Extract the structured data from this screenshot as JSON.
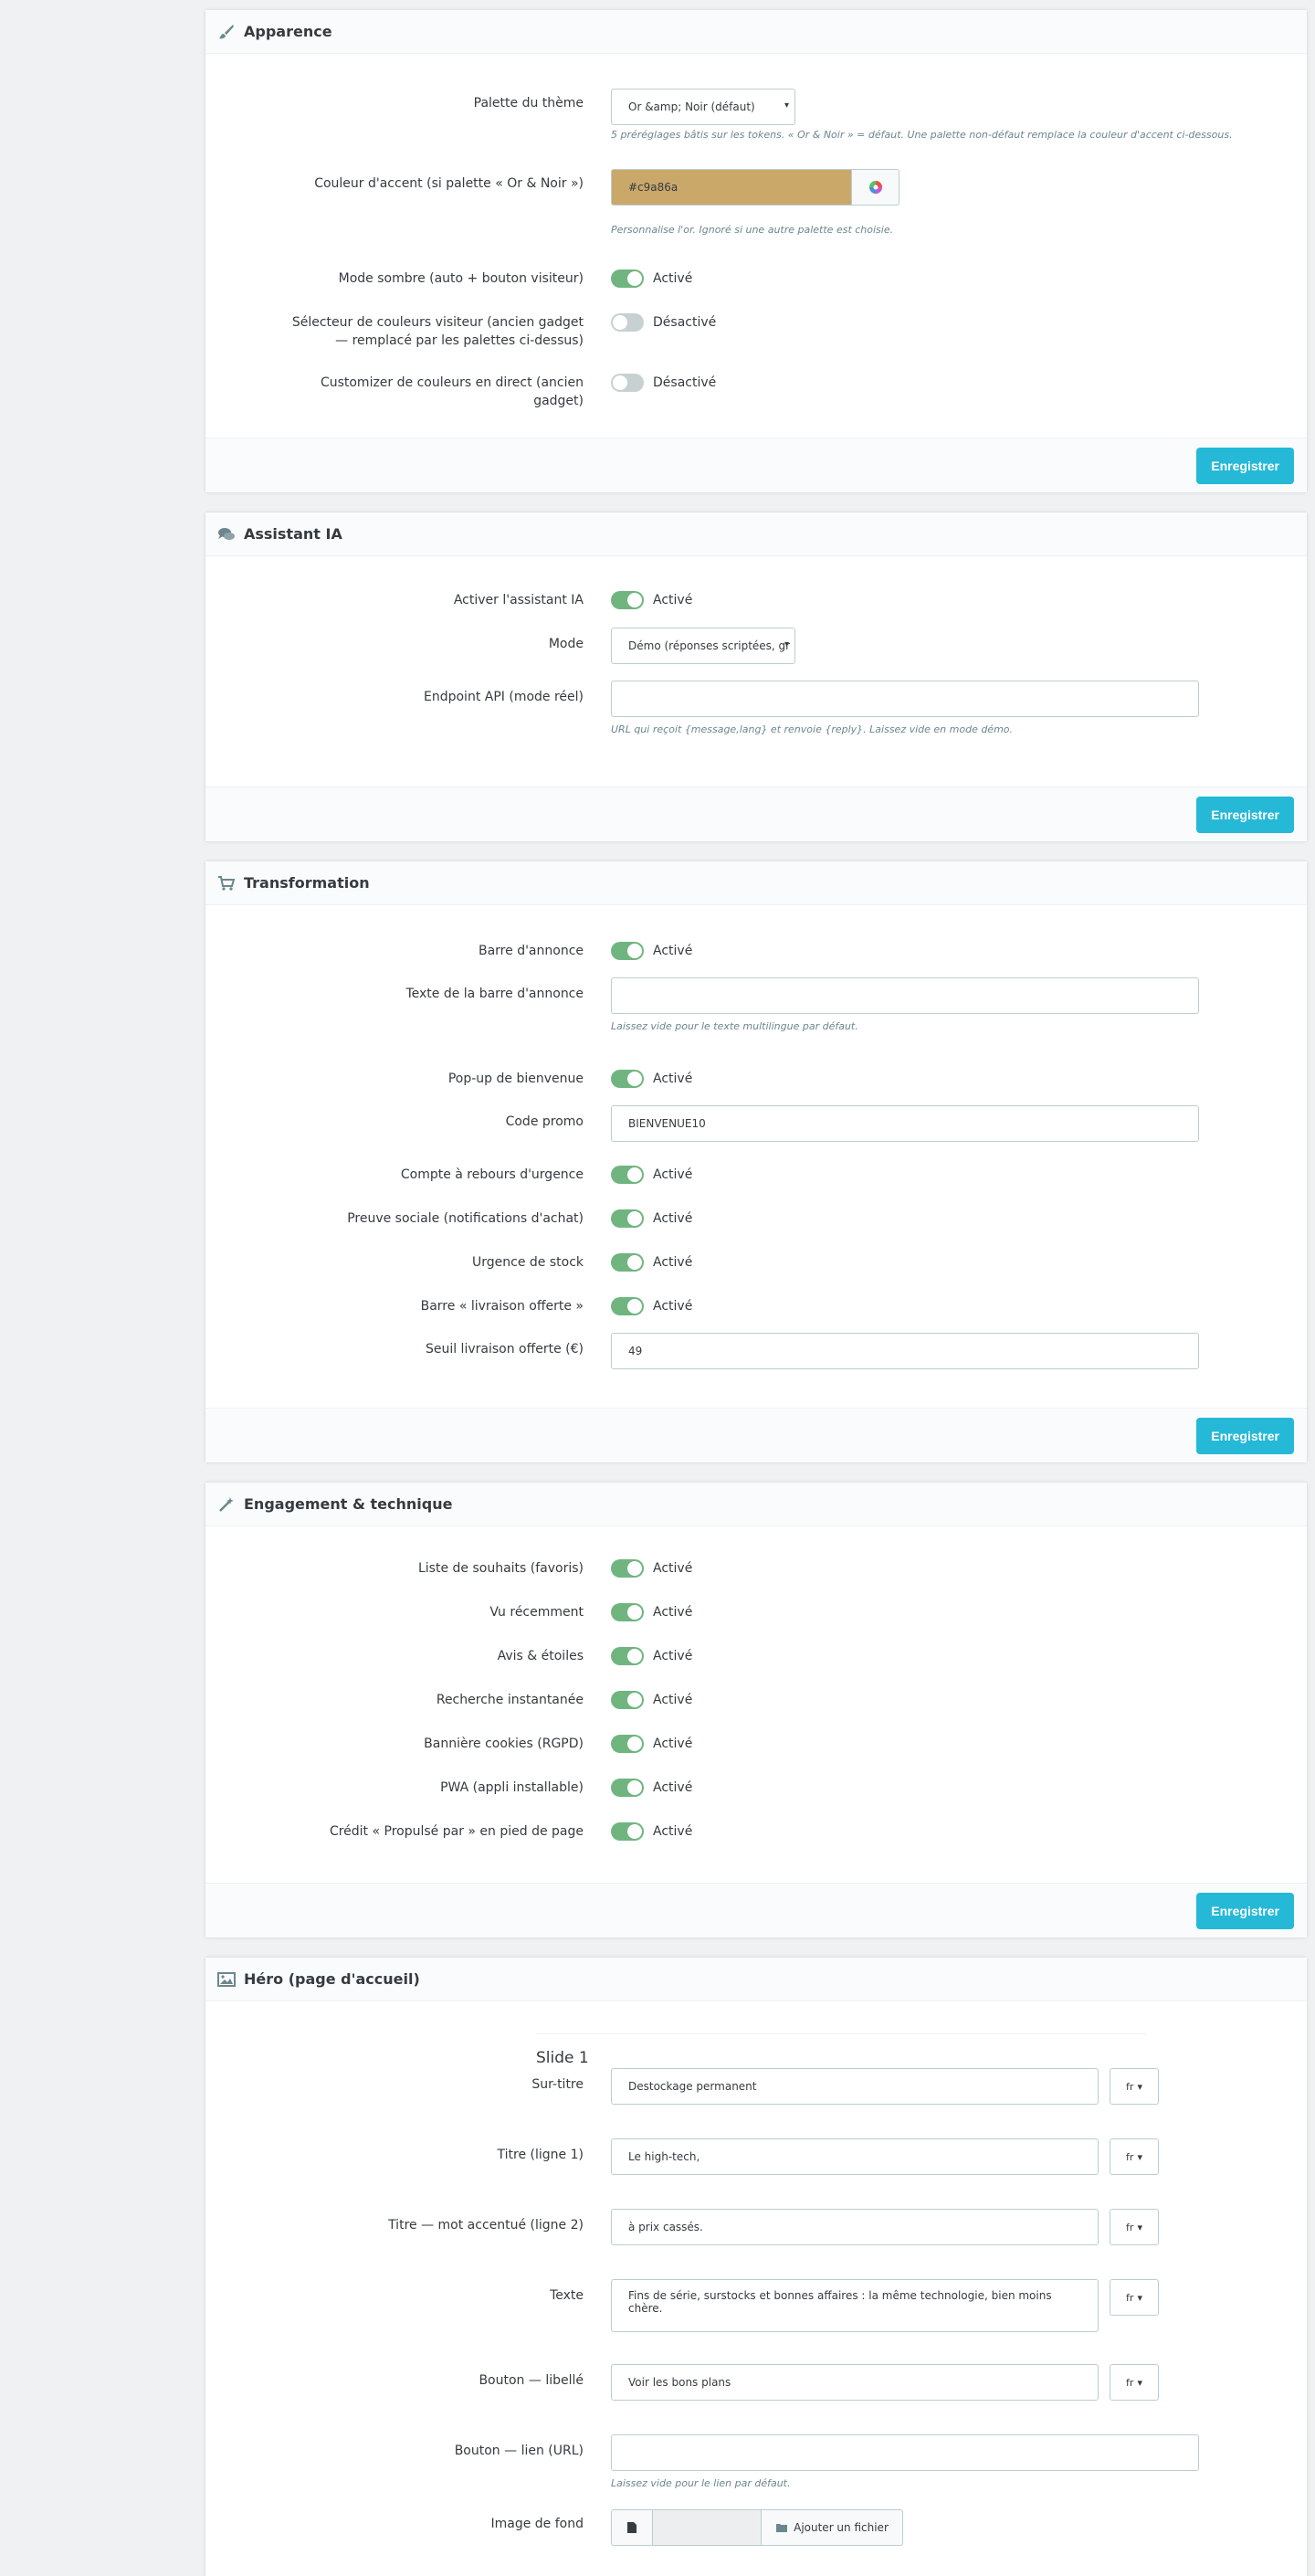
{
  "apparence": {
    "title": "Apparence",
    "palette_label": "Palette du thème",
    "palette_value": "Or &amp; Noir (défaut)",
    "palette_help": "5 préréglages bâtis sur les tokens. « Or & Noir » = défaut. Une palette non-défaut remplace la couleur d'accent ci-dessous.",
    "accent_label": "Couleur d'accent (si palette « Or & Noir »)",
    "accent_value": "#c9a86a",
    "accent_color": "#c9a86a",
    "accent_help": "Personnalise l'or. Ignoré si une autre palette est choisie.",
    "dark_label": "Mode sombre (auto + bouton visiteur)",
    "dark_state": "Activé",
    "picker_label": "Sélecteur de couleurs visiteur (ancien gadget — remplacé par les palettes ci-dessus)",
    "picker_state": "Désactivé",
    "customizer_label": "Customizer de couleurs en direct (ancien gadget)",
    "customizer_state": "Désactivé",
    "save": "Enregistrer"
  },
  "assistant": {
    "title": "Assistant IA",
    "enable_label": "Activer l'assistant IA",
    "enable_state": "Activé",
    "mode_label": "Mode",
    "mode_value": "Démo (réponses scriptées, gr",
    "endpoint_label": "Endpoint API (mode réel)",
    "endpoint_value": "",
    "endpoint_help": "URL qui reçoit {message,lang} et renvoie {reply}. Laissez vide en mode démo.",
    "save": "Enregistrer"
  },
  "transformation": {
    "title": "Transformation",
    "bar_label": "Barre d'annonce",
    "bar_state": "Activé",
    "bar_text_label": "Texte de la barre d'annonce",
    "bar_text_value": "",
    "bar_text_help": "Laissez vide pour le texte multilingue par défaut.",
    "popup_label": "Pop-up de bienvenue",
    "popup_state": "Activé",
    "promo_label": "Code promo",
    "promo_value": "BIENVENUE10",
    "countdown_label": "Compte à rebours d'urgence",
    "countdown_state": "Activé",
    "social_label": "Preuve sociale (notifications d'achat)",
    "social_state": "Activé",
    "stock_label": "Urgence de stock",
    "stock_state": "Activé",
    "shipping_bar_label": "Barre « livraison offerte »",
    "shipping_bar_state": "Activé",
    "threshold_label": "Seuil livraison offerte (€)",
    "threshold_value": "49",
    "save": "Enregistrer"
  },
  "engagement": {
    "title": "Engagement & technique",
    "items": [
      {
        "label": "Liste de souhaits (favoris)",
        "state": "Activé"
      },
      {
        "label": "Vu récemment",
        "state": "Activé"
      },
      {
        "label": "Avis & étoiles",
        "state": "Activé"
      },
      {
        "label": "Recherche instantanée",
        "state": "Activé"
      },
      {
        "label": "Bannière cookies (RGPD)",
        "state": "Activé"
      },
      {
        "label": "PWA (appli installable)",
        "state": "Activé"
      },
      {
        "label": "Crédit « Propulsé par » en pied de page",
        "state": "Activé"
      }
    ],
    "save": "Enregistrer"
  },
  "hero": {
    "title": "Héro (page d'accueil)",
    "slide_title": "Slide 1",
    "lang": "fr",
    "surtitle_label": "Sur-titre",
    "surtitle_value": "Destockage permanent",
    "title1_label": "Titre (ligne 1)",
    "title1_value": "Le high-tech,",
    "title2_label": "Titre — mot accentué (ligne 2)",
    "title2_value": "à prix cassés.",
    "text_label": "Texte",
    "text_value": "Fins de série, surstocks et bonnes affaires : la même technologie, bien moins chère.",
    "btn_label_label": "Bouton — libellé",
    "btn_label_value": "Voir les bons plans",
    "btn_link_label": "Bouton — lien (URL)",
    "btn_link_value": "",
    "btn_link_help": "Laissez vide pour le lien par défaut.",
    "bg_label": "Image de fond",
    "add_file": "Ajouter un fichier"
  }
}
